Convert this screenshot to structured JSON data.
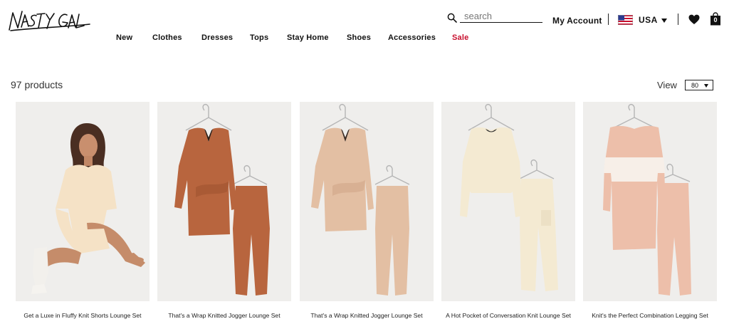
{
  "header": {
    "logo_text": "NASTY GAL",
    "search_placeholder": "search",
    "account_label": "My Account",
    "country_label": "USA",
    "bag_count": "0"
  },
  "nav": {
    "items": [
      "New",
      "Clothes",
      "Dresses",
      "Tops",
      "Stay Home",
      "Shoes",
      "Accessories",
      "Sale"
    ]
  },
  "listing": {
    "product_count": "97 products",
    "view_label": "View",
    "view_value": "80"
  },
  "products": [
    {
      "name": "Get a Luxe in Fluffy Knit Shorts Lounge Set",
      "color": "#f5e2c6"
    },
    {
      "name": "That's a Wrap Knitted Jogger Lounge Set",
      "color": "#b8653e"
    },
    {
      "name": "That's a Wrap Knitted Jogger Lounge Set",
      "color": "#e3bfa3"
    },
    {
      "name": "A Hot Pocket of Conversation Knit Lounge Set",
      "color": "#f4ead2"
    },
    {
      "name": "Knit's the Perfect Combination Legging Set",
      "color": "#edbfaa"
    }
  ],
  "colors": {
    "text": "#111111",
    "sale": "#c8102e",
    "photo_background": "#efeeec"
  },
  "icons": [
    "search-icon",
    "flag-usa-icon",
    "chevron-down-icon",
    "heart-icon",
    "bag-icon"
  ]
}
